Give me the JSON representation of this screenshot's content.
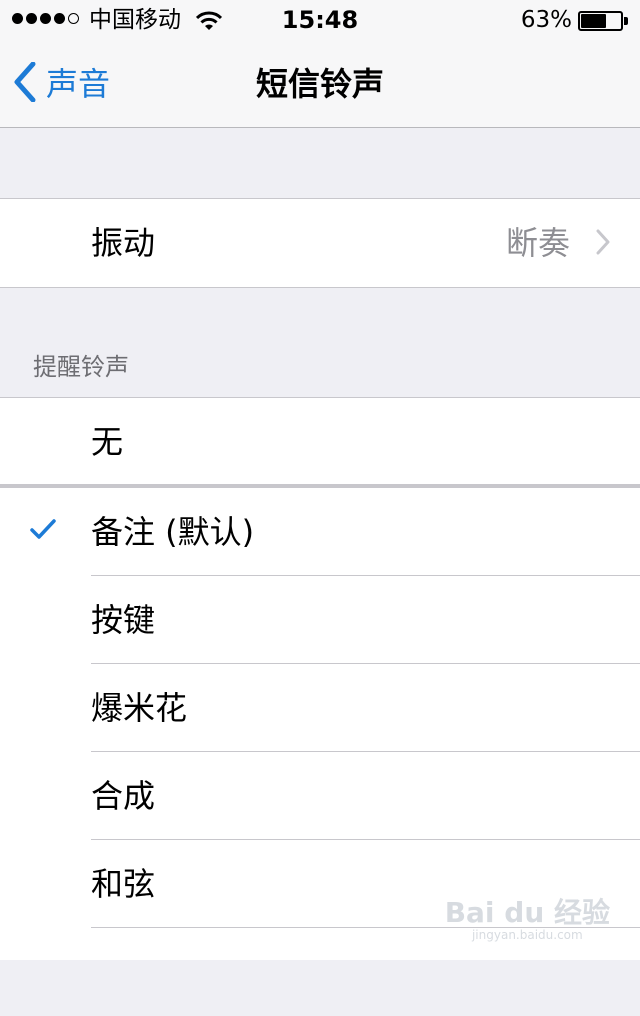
{
  "status_bar": {
    "carrier": "中国移动",
    "time": "15:48",
    "battery_percent": "63%",
    "battery_level": 0.63,
    "signal_bars": 4
  },
  "nav": {
    "back_label": "声音",
    "title": "短信铃声"
  },
  "vibration": {
    "label": "振动",
    "value": "断奏"
  },
  "alert_section": {
    "header": "提醒铃声",
    "none_label": "无"
  },
  "tones": [
    {
      "label": "备注 (默认)",
      "selected": true
    },
    {
      "label": "按键",
      "selected": false
    },
    {
      "label": "爆米花",
      "selected": false
    },
    {
      "label": "合成",
      "selected": false
    },
    {
      "label": "和弦",
      "selected": false
    },
    {
      "label": "",
      "selected": false
    }
  ],
  "colors": {
    "accent": "#1d7bd6",
    "background": "#efeff4",
    "secondary_text": "#8e8e93"
  },
  "icons": [
    "back-chevron-icon",
    "wifi-icon",
    "battery-icon",
    "chevron-right-icon",
    "checkmark-icon"
  ],
  "watermark": {
    "logo": "Bai du 经验",
    "sub": "jingyan.baidu.com"
  }
}
